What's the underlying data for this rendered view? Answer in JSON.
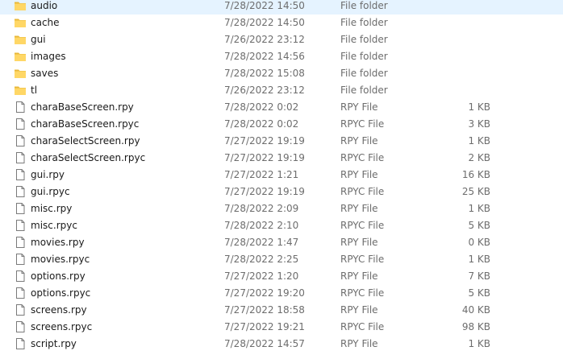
{
  "files": [
    {
      "name": "audio",
      "date": "7/28/2022 14:50",
      "type": "File folder",
      "size": "",
      "icon": "folder-icon"
    },
    {
      "name": "cache",
      "date": "7/28/2022 14:50",
      "type": "File folder",
      "size": "",
      "icon": "folder-icon"
    },
    {
      "name": "gui",
      "date": "7/26/2022 23:12",
      "type": "File folder",
      "size": "",
      "icon": "folder-icon"
    },
    {
      "name": "images",
      "date": "7/28/2022 14:56",
      "type": "File folder",
      "size": "",
      "icon": "folder-icon"
    },
    {
      "name": "saves",
      "date": "7/28/2022 15:08",
      "type": "File folder",
      "size": "",
      "icon": "folder-icon"
    },
    {
      "name": "tl",
      "date": "7/26/2022 23:12",
      "type": "File folder",
      "size": "",
      "icon": "folder-icon"
    },
    {
      "name": "charaBaseScreen.rpy",
      "date": "7/28/2022 0:02",
      "type": "RPY File",
      "size": "1 KB",
      "icon": "file-icon"
    },
    {
      "name": "charaBaseScreen.rpyc",
      "date": "7/28/2022 0:02",
      "type": "RPYC File",
      "size": "3 KB",
      "icon": "file-icon"
    },
    {
      "name": "charaSelectScreen.rpy",
      "date": "7/27/2022 19:19",
      "type": "RPY File",
      "size": "1 KB",
      "icon": "file-icon"
    },
    {
      "name": "charaSelectScreen.rpyc",
      "date": "7/27/2022 19:19",
      "type": "RPYC File",
      "size": "2 KB",
      "icon": "file-icon"
    },
    {
      "name": "gui.rpy",
      "date": "7/27/2022 1:21",
      "type": "RPY File",
      "size": "16 KB",
      "icon": "file-icon"
    },
    {
      "name": "gui.rpyc",
      "date": "7/27/2022 19:19",
      "type": "RPYC File",
      "size": "25 KB",
      "icon": "file-icon"
    },
    {
      "name": "misc.rpy",
      "date": "7/28/2022 2:09",
      "type": "RPY File",
      "size": "1 KB",
      "icon": "file-icon"
    },
    {
      "name": "misc.rpyc",
      "date": "7/28/2022 2:10",
      "type": "RPYC File",
      "size": "5 KB",
      "icon": "file-icon"
    },
    {
      "name": "movies.rpy",
      "date": "7/28/2022 1:47",
      "type": "RPY File",
      "size": "0 KB",
      "icon": "file-icon"
    },
    {
      "name": "movies.rpyc",
      "date": "7/28/2022 2:25",
      "type": "RPYC File",
      "size": "1 KB",
      "icon": "file-icon"
    },
    {
      "name": "options.rpy",
      "date": "7/27/2022 1:20",
      "type": "RPY File",
      "size": "7 KB",
      "icon": "file-icon"
    },
    {
      "name": "options.rpyc",
      "date": "7/27/2022 19:20",
      "type": "RPYC File",
      "size": "5 KB",
      "icon": "file-icon"
    },
    {
      "name": "screens.rpy",
      "date": "7/27/2022 18:58",
      "type": "RPY File",
      "size": "40 KB",
      "icon": "file-icon"
    },
    {
      "name": "screens.rpyc",
      "date": "7/27/2022 19:21",
      "type": "RPYC File",
      "size": "98 KB",
      "icon": "file-icon"
    },
    {
      "name": "script.rpy",
      "date": "7/28/2022 14:57",
      "type": "RPY File",
      "size": "1 KB",
      "icon": "file-icon"
    }
  ],
  "colors": {
    "folder_body": "#ffd766",
    "folder_tab": "#e8b83a",
    "file_stroke": "#7a7a7a",
    "meta_text": "#6d6d6d"
  }
}
